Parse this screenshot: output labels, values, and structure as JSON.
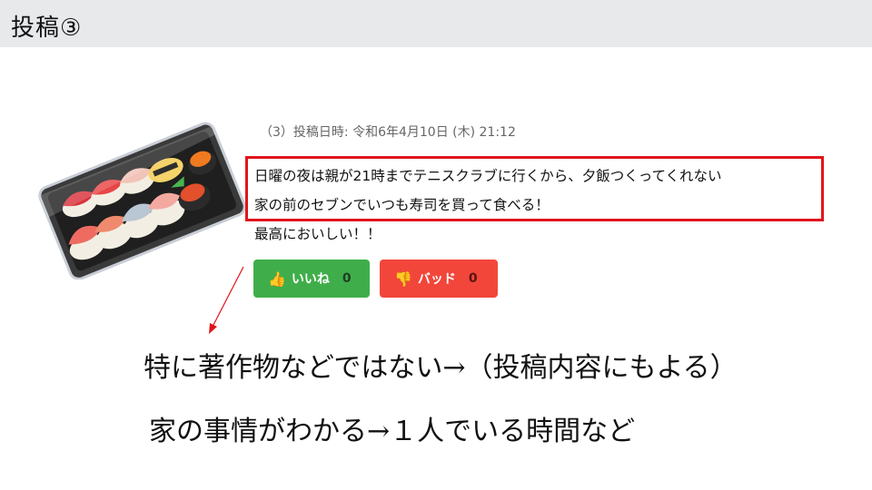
{
  "slide": {
    "title": "投稿③"
  },
  "post": {
    "meta": "（3）投稿日時: 令和6年4月10日 (木) 21:12",
    "body_lines": [
      "日曜の夜は親が21時までテニスクラブに行くから、夕飯つくってくれない",
      "家の前のセブンでいつも寿司を買って食べる！",
      "最高においしい！！"
    ],
    "like_button": {
      "label": "いいね",
      "count": "0"
    },
    "bad_button": {
      "label": "バッド",
      "count": "0"
    }
  },
  "notes": [
    "特に著作物などではない→（投稿内容にもよる）",
    "家の事情がわかる→１人でいる時間など"
  ],
  "colors": {
    "highlight": "#e0151b",
    "like": "#3fae4a",
    "bad": "#f2463b",
    "title_bar": "#e8e9eb"
  },
  "icons": {
    "like": "thumbs-up-icon",
    "bad": "thumbs-down-icon",
    "image": "sushi-tray-image"
  }
}
